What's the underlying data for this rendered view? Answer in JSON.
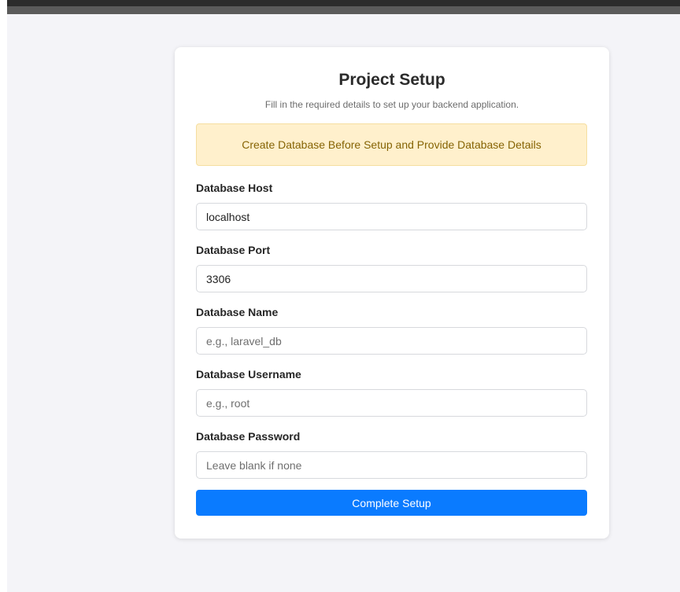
{
  "setup": {
    "title": "Project Setup",
    "subtitle": "Fill in the required details to set up your backend application.",
    "alert": "Create Database Before Setup and Provide Database Details"
  },
  "fields": {
    "host": {
      "label": "Database Host",
      "value": "localhost",
      "placeholder": ""
    },
    "port": {
      "label": "Database Port",
      "value": "3306",
      "placeholder": ""
    },
    "name": {
      "label": "Database Name",
      "value": "",
      "placeholder": "e.g., laravel_db"
    },
    "username": {
      "label": "Database Username",
      "value": "",
      "placeholder": "e.g., root"
    },
    "password": {
      "label": "Database Password",
      "value": "",
      "placeholder": "Leave blank if none"
    }
  },
  "submit": {
    "label": "Complete Setup"
  },
  "colors": {
    "page_background": "#f4f4f8",
    "card_background": "#ffffff",
    "alert_background": "#fff0cc",
    "alert_text": "#856404",
    "primary_button": "#0a7bff"
  }
}
